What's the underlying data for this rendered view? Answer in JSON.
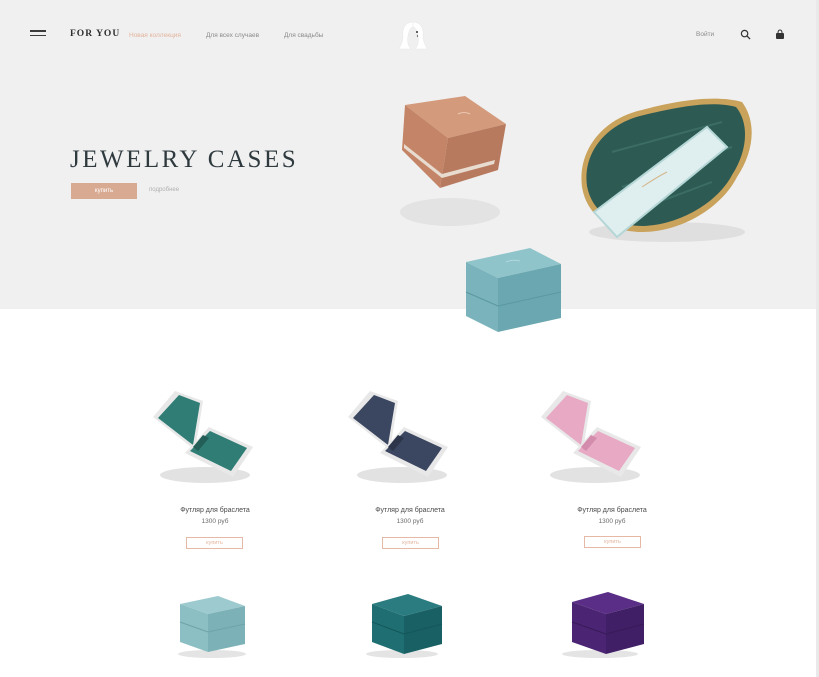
{
  "nav": {
    "brand": "FOR YOU",
    "links": [
      "Новая коллекция",
      "Для всех случаев",
      "Для свадьбы"
    ],
    "login": "Войти"
  },
  "hero": {
    "title": "JEWELRY CASES",
    "buy_label": "купить",
    "more_label": "подробнее"
  },
  "products": [
    {
      "name": "Футляр для браслета",
      "price": "1300 руб",
      "buy": "купить",
      "color": "#2f7d75"
    },
    {
      "name": "Футляр для браслета",
      "price": "1300 руб",
      "buy": "купить",
      "color": "#3b4660"
    },
    {
      "name": "Футляр для браслета",
      "price": "1300 руб",
      "buy": "купить",
      "color": "#e7a9c4"
    }
  ],
  "products_row2": [
    {
      "color": "#8cbfc3"
    },
    {
      "color": "#1e6e72"
    },
    {
      "color": "#4b2574"
    }
  ],
  "colors": {
    "accent": "#d8aa92",
    "active_link": "#e2b49c",
    "hero_bg": "#f0f0f0",
    "title": "#2f3a3f"
  }
}
